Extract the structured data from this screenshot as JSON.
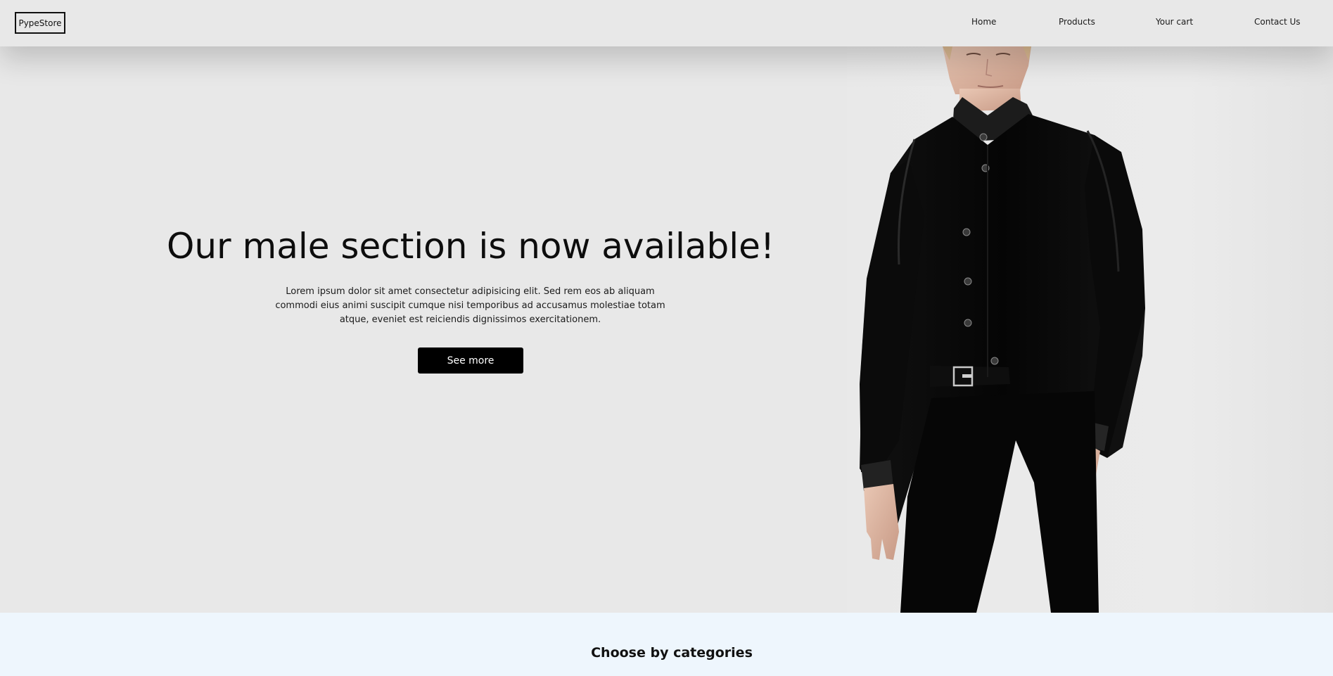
{
  "brand": {
    "logo_text": "PypeStore"
  },
  "nav": {
    "items": [
      {
        "label": "Home"
      },
      {
        "label": "Products"
      },
      {
        "label": "Your cart"
      },
      {
        "label": "Contact Us"
      }
    ]
  },
  "hero": {
    "title": "Our male section is now available!",
    "description": "Lorem ipsum dolor sit amet consectetur adipisicing elit. Sed rem eos ab aliquam commodi eius animi suscipit cumque nisi temporibus ad accusamus molestiae totam atque, eveniet est reiciendis dignissimos exercitationem.",
    "cta_label": "See more",
    "image_alt": "male model in black velvet suit"
  },
  "categories": {
    "title": "Choose by categories"
  },
  "colors": {
    "background": "#e8e8e8",
    "button": "#000000",
    "button_text": "#ffffff",
    "categories_background": "#eef6fd"
  }
}
